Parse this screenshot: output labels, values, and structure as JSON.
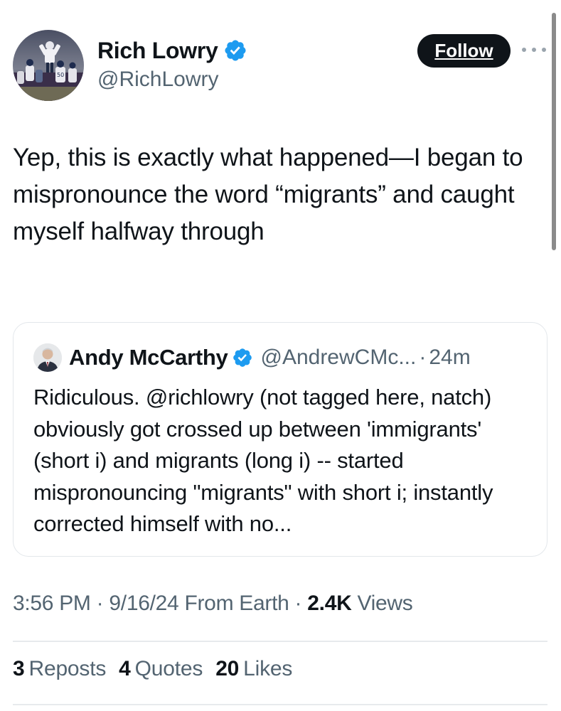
{
  "tweet": {
    "author": {
      "name": "Rich Lowry",
      "handle": "@RichLowry",
      "verified": true
    },
    "follow_label": "Follow",
    "text": "Yep, this is exactly what happened—I began to mispronounce the word “migrants” and caught myself halfway through",
    "quote": {
      "author_name": "Andy McCarthy",
      "author_handle": "@AndrewCMc...",
      "separator": "·",
      "time_ago": "24m",
      "verified": true,
      "text": "Ridiculous. @richlowry (not tagged here, natch) obviously got crossed up between 'immigrants' (short i) and migrants (long i) -- started mispronouncing \"migrants\" with short i; instantly corrected himself with no..."
    },
    "meta": {
      "time": "3:56 PM",
      "sep1": "·",
      "date": "9/16/24",
      "source": "From Earth",
      "sep2": "·",
      "views_count": "2.4K",
      "views_label": "Views"
    },
    "stats": [
      {
        "count": "3",
        "label": "Reposts"
      },
      {
        "count": "4",
        "label": "Quotes"
      },
      {
        "count": "20",
        "label": "Likes"
      }
    ]
  },
  "colors": {
    "verified_blue": "#1d9bf0",
    "text_primary": "#0f1419",
    "text_secondary": "#536471",
    "follow_bg": "#0f1419",
    "border": "#e3e7eb"
  },
  "icons": [
    "verified-badge-icon",
    "more-options-icon"
  ]
}
